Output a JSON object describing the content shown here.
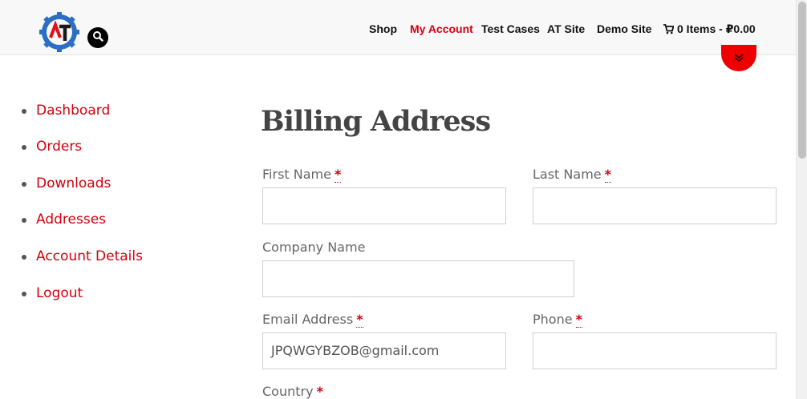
{
  "header": {
    "nav": {
      "shop": "Shop",
      "my_account": "My Account",
      "test_cases": "Test Cases",
      "at_site": "AT Site",
      "demo_site": "Demo Site",
      "cart": "0 Items - ₽0.00"
    },
    "logo_letters": "AT"
  },
  "sidebar": {
    "items": [
      {
        "label": "Dashboard"
      },
      {
        "label": "Orders"
      },
      {
        "label": "Downloads"
      },
      {
        "label": "Addresses"
      },
      {
        "label": "Account Details"
      },
      {
        "label": "Logout"
      }
    ]
  },
  "form": {
    "title": "Billing Address",
    "required_mark": "*",
    "first_name": {
      "label": "First Name",
      "value": ""
    },
    "last_name": {
      "label": "Last Name",
      "value": ""
    },
    "company": {
      "label": "Company Name",
      "value": ""
    },
    "email": {
      "label": "Email Address",
      "value": "JPQWGYBZOB@gmail.com"
    },
    "phone": {
      "label": "Phone",
      "value": ""
    },
    "country": {
      "label": "Country"
    }
  },
  "colors": {
    "accent": "#d5000d",
    "scroll_button": "#ee0000",
    "header_bg": "#f8f8f8"
  },
  "icons": {
    "search": "search-icon",
    "cart": "cart-icon",
    "scroll_down": "double-chevron-down-icon",
    "logo": "gear-logo-icon"
  }
}
